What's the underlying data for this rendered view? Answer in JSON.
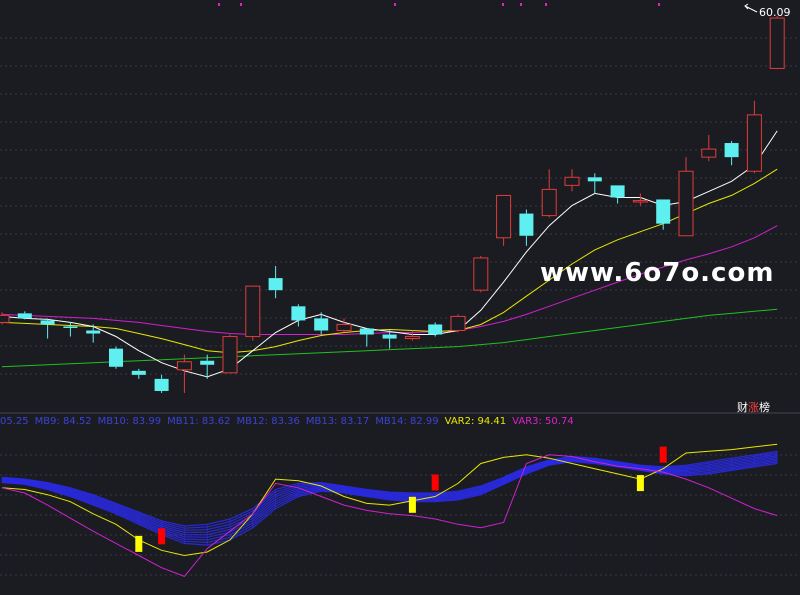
{
  "price_label": "60.09",
  "watermark": "www.6o7o.com",
  "brand": {
    "part1": "财",
    "part2": "涨",
    "part3": "榜"
  },
  "legend": {
    "mb_items": [
      "05.25",
      "MB9: 84.52",
      "MB10: 83.99",
      "MB11: 83.62",
      "MB12: 83.36",
      "MB13: 83.17",
      "MB14: 82.99"
    ],
    "var2": "VAR2: 94.41",
    "var3": "VAR3: 50.74"
  },
  "colors": {
    "background": "#1b1c21",
    "up_candle": "#e03b3b",
    "down_candle": "#5ef0f0",
    "ma5": "#ffffff",
    "ma10": "#e8e800",
    "ma20": "#d020d0",
    "ma60": "#20c020",
    "ribbon": "#2a2ae8",
    "signal_yellow": "#ffff00",
    "signal_red": "#ff0000",
    "grid": "#3a3a44"
  },
  "chart_data": [
    {
      "type": "candlestick",
      "title": "",
      "price_max_label": "60.09",
      "candles": [
        {
          "o": 1.0,
          "c": 1.35,
          "h": 1.5,
          "l": 0.9
        },
        {
          "o": 1.45,
          "c": 1.2,
          "h": 1.55,
          "l": 1.15
        },
        {
          "o": 1.1,
          "c": 0.9,
          "h": 1.2,
          "l": 0.2
        },
        {
          "o": 0.8,
          "c": 0.75,
          "h": 1.0,
          "l": 0.3
        },
        {
          "o": 0.6,
          "c": 0.45,
          "h": 0.9,
          "l": 0.0
        },
        {
          "o": -0.3,
          "c": -1.2,
          "h": -0.2,
          "l": -1.3
        },
        {
          "o": -1.4,
          "c": -1.6,
          "h": -1.3,
          "l": -1.8
        },
        {
          "o": -1.8,
          "c": -2.4,
          "h": -1.6,
          "l": -2.5
        },
        {
          "o": -1.35,
          "c": -0.95,
          "h": -0.6,
          "l": -2.5
        },
        {
          "o": -0.9,
          "c": -1.1,
          "h": -0.6,
          "l": -1.8
        },
        {
          "o": -1.5,
          "c": 0.3,
          "h": 0.4,
          "l": -1.5
        },
        {
          "o": 0.3,
          "c": 2.8,
          "h": 2.8,
          "l": 0.1
        },
        {
          "o": 3.2,
          "c": 2.6,
          "h": 3.8,
          "l": 2.2
        },
        {
          "o": 1.8,
          "c": 1.1,
          "h": 1.9,
          "l": 0.8
        },
        {
          "o": 1.2,
          "c": 0.6,
          "h": 1.5,
          "l": 0.4
        },
        {
          "o": 0.6,
          "c": 0.9,
          "h": 1.2,
          "l": 0.5
        },
        {
          "o": 0.7,
          "c": 0.4,
          "h": 0.7,
          "l": -0.2
        },
        {
          "o": 0.4,
          "c": 0.2,
          "h": 0.6,
          "l": -0.3
        },
        {
          "o": 0.2,
          "c": 0.3,
          "h": 0.6,
          "l": 0.1
        },
        {
          "o": 0.9,
          "c": 0.4,
          "h": 1.0,
          "l": 0.3
        },
        {
          "o": 0.6,
          "c": 1.3,
          "h": 1.4,
          "l": 0.5
        },
        {
          "o": 2.6,
          "c": 4.2,
          "h": 4.3,
          "l": 2.5
        },
        {
          "o": 5.2,
          "c": 7.3,
          "h": 7.3,
          "l": 4.8
        },
        {
          "o": 6.4,
          "c": 5.3,
          "h": 6.6,
          "l": 4.8
        },
        {
          "o": 6.3,
          "c": 7.6,
          "h": 8.6,
          "l": 6.2
        },
        {
          "o": 7.8,
          "c": 8.2,
          "h": 8.6,
          "l": 7.5
        },
        {
          "o": 8.2,
          "c": 8.0,
          "h": 8.4,
          "l": 7.4
        },
        {
          "o": 7.8,
          "c": 7.2,
          "h": 7.8,
          "l": 6.9
        },
        {
          "o": 7.05,
          "c": 7.05,
          "h": 7.4,
          "l": 6.8
        },
        {
          "o": 7.1,
          "c": 5.9,
          "h": 7.1,
          "l": 5.6
        },
        {
          "o": 5.3,
          "c": 8.5,
          "h": 9.2,
          "l": 5.3
        },
        {
          "o": 9.2,
          "c": 9.6,
          "h": 10.3,
          "l": 9.0
        },
        {
          "o": 9.9,
          "c": 9.2,
          "h": 10.0,
          "l": 8.8
        },
        {
          "o": 8.5,
          "c": 11.3,
          "h": 12.0,
          "l": 8.4
        },
        {
          "o": 13.6,
          "c": 16.1,
          "h": 16.2,
          "l": 13.6
        }
      ],
      "ma5": [
        1.3,
        1.2,
        1.15,
        1.0,
        0.8,
        0.3,
        -0.4,
        -1.0,
        -1.4,
        -1.7,
        -1.3,
        -0.4,
        0.5,
        1.1,
        1.4,
        1.0,
        0.7,
        0.55,
        0.4,
        0.4,
        0.6,
        1.6,
        3.0,
        4.5,
        5.8,
        6.8,
        7.4,
        7.2,
        7.2,
        6.8,
        7.0,
        7.5,
        8.0,
        8.8,
        10.5
      ],
      "ma10": [
        1.0,
        0.95,
        0.9,
        0.85,
        0.8,
        0.7,
        0.45,
        0.2,
        -0.1,
        -0.4,
        -0.5,
        -0.4,
        -0.2,
        0.1,
        0.35,
        0.5,
        0.6,
        0.65,
        0.6,
        0.55,
        0.6,
        0.9,
        1.5,
        2.3,
        3.1,
        3.9,
        4.6,
        5.1,
        5.5,
        5.9,
        6.4,
        6.9,
        7.3,
        7.9,
        8.6
      ],
      "ma20": [
        1.4,
        1.35,
        1.3,
        1.25,
        1.2,
        1.1,
        1.0,
        0.85,
        0.7,
        0.55,
        0.45,
        0.4,
        0.4,
        0.4,
        0.4,
        0.4,
        0.45,
        0.5,
        0.5,
        0.55,
        0.6,
        0.8,
        1.05,
        1.4,
        1.8,
        2.2,
        2.6,
        3.0,
        3.4,
        3.75,
        4.1,
        4.4,
        4.75,
        5.2,
        5.8
      ],
      "ma60": [
        -1.2,
        -1.15,
        -1.1,
        -1.05,
        -1.0,
        -0.95,
        -0.9,
        -0.85,
        -0.8,
        -0.75,
        -0.7,
        -0.65,
        -0.6,
        -0.55,
        -0.5,
        -0.45,
        -0.4,
        -0.35,
        -0.3,
        -0.25,
        -0.2,
        -0.1,
        0.0,
        0.15,
        0.3,
        0.45,
        0.6,
        0.75,
        0.9,
        1.05,
        1.2,
        1.35,
        1.45,
        1.55,
        1.65
      ]
    },
    {
      "type": "line",
      "title": "",
      "series": [
        {
          "name": "VAR2",
          "values": [
            90,
            88,
            82,
            74,
            60,
            48,
            30,
            18,
            12,
            16,
            30,
            60,
            100,
            98,
            92,
            80,
            72,
            70,
            75,
            80,
            95,
            118,
            125,
            128,
            124,
            118,
            112,
            106,
            100,
            112,
            130,
            132,
            134,
            137,
            140
          ]
        },
        {
          "name": "VAR3",
          "values": [
            90,
            84,
            70,
            55,
            40,
            26,
            12,
            -2,
            -12,
            20,
            40,
            60,
            95,
            90,
            80,
            70,
            64,
            60,
            58,
            54,
            48,
            44,
            50,
            118,
            128,
            126,
            120,
            115,
            112,
            108,
            100,
            90,
            78,
            66,
            58
          ]
        }
      ],
      "ribbon_top": [
        102,
        100,
        96,
        90,
        82,
        72,
        62,
        52,
        46,
        48,
        54,
        66,
        88,
        95,
        96,
        92,
        88,
        85,
        84,
        84,
        86,
        92,
        102,
        114,
        122,
        126,
        124,
        120,
        116,
        114,
        116,
        120,
        124,
        128,
        132
      ],
      "ribbon_bottom": [
        96,
        94,
        88,
        80,
        70,
        60,
        48,
        36,
        26,
        24,
        30,
        44,
        66,
        80,
        86,
        84,
        80,
        76,
        74,
        74,
        76,
        82,
        94,
        106,
        116,
        120,
        118,
        114,
        110,
        106,
        104,
        106,
        110,
        114,
        118
      ],
      "signals": [
        {
          "index": 6,
          "color": "yellow"
        },
        {
          "index": 7,
          "color": "red"
        },
        {
          "index": 18,
          "color": "yellow"
        },
        {
          "index": 19,
          "color": "red"
        },
        {
          "index": 28,
          "color": "yellow"
        },
        {
          "index": 29,
          "color": "red"
        }
      ]
    }
  ]
}
